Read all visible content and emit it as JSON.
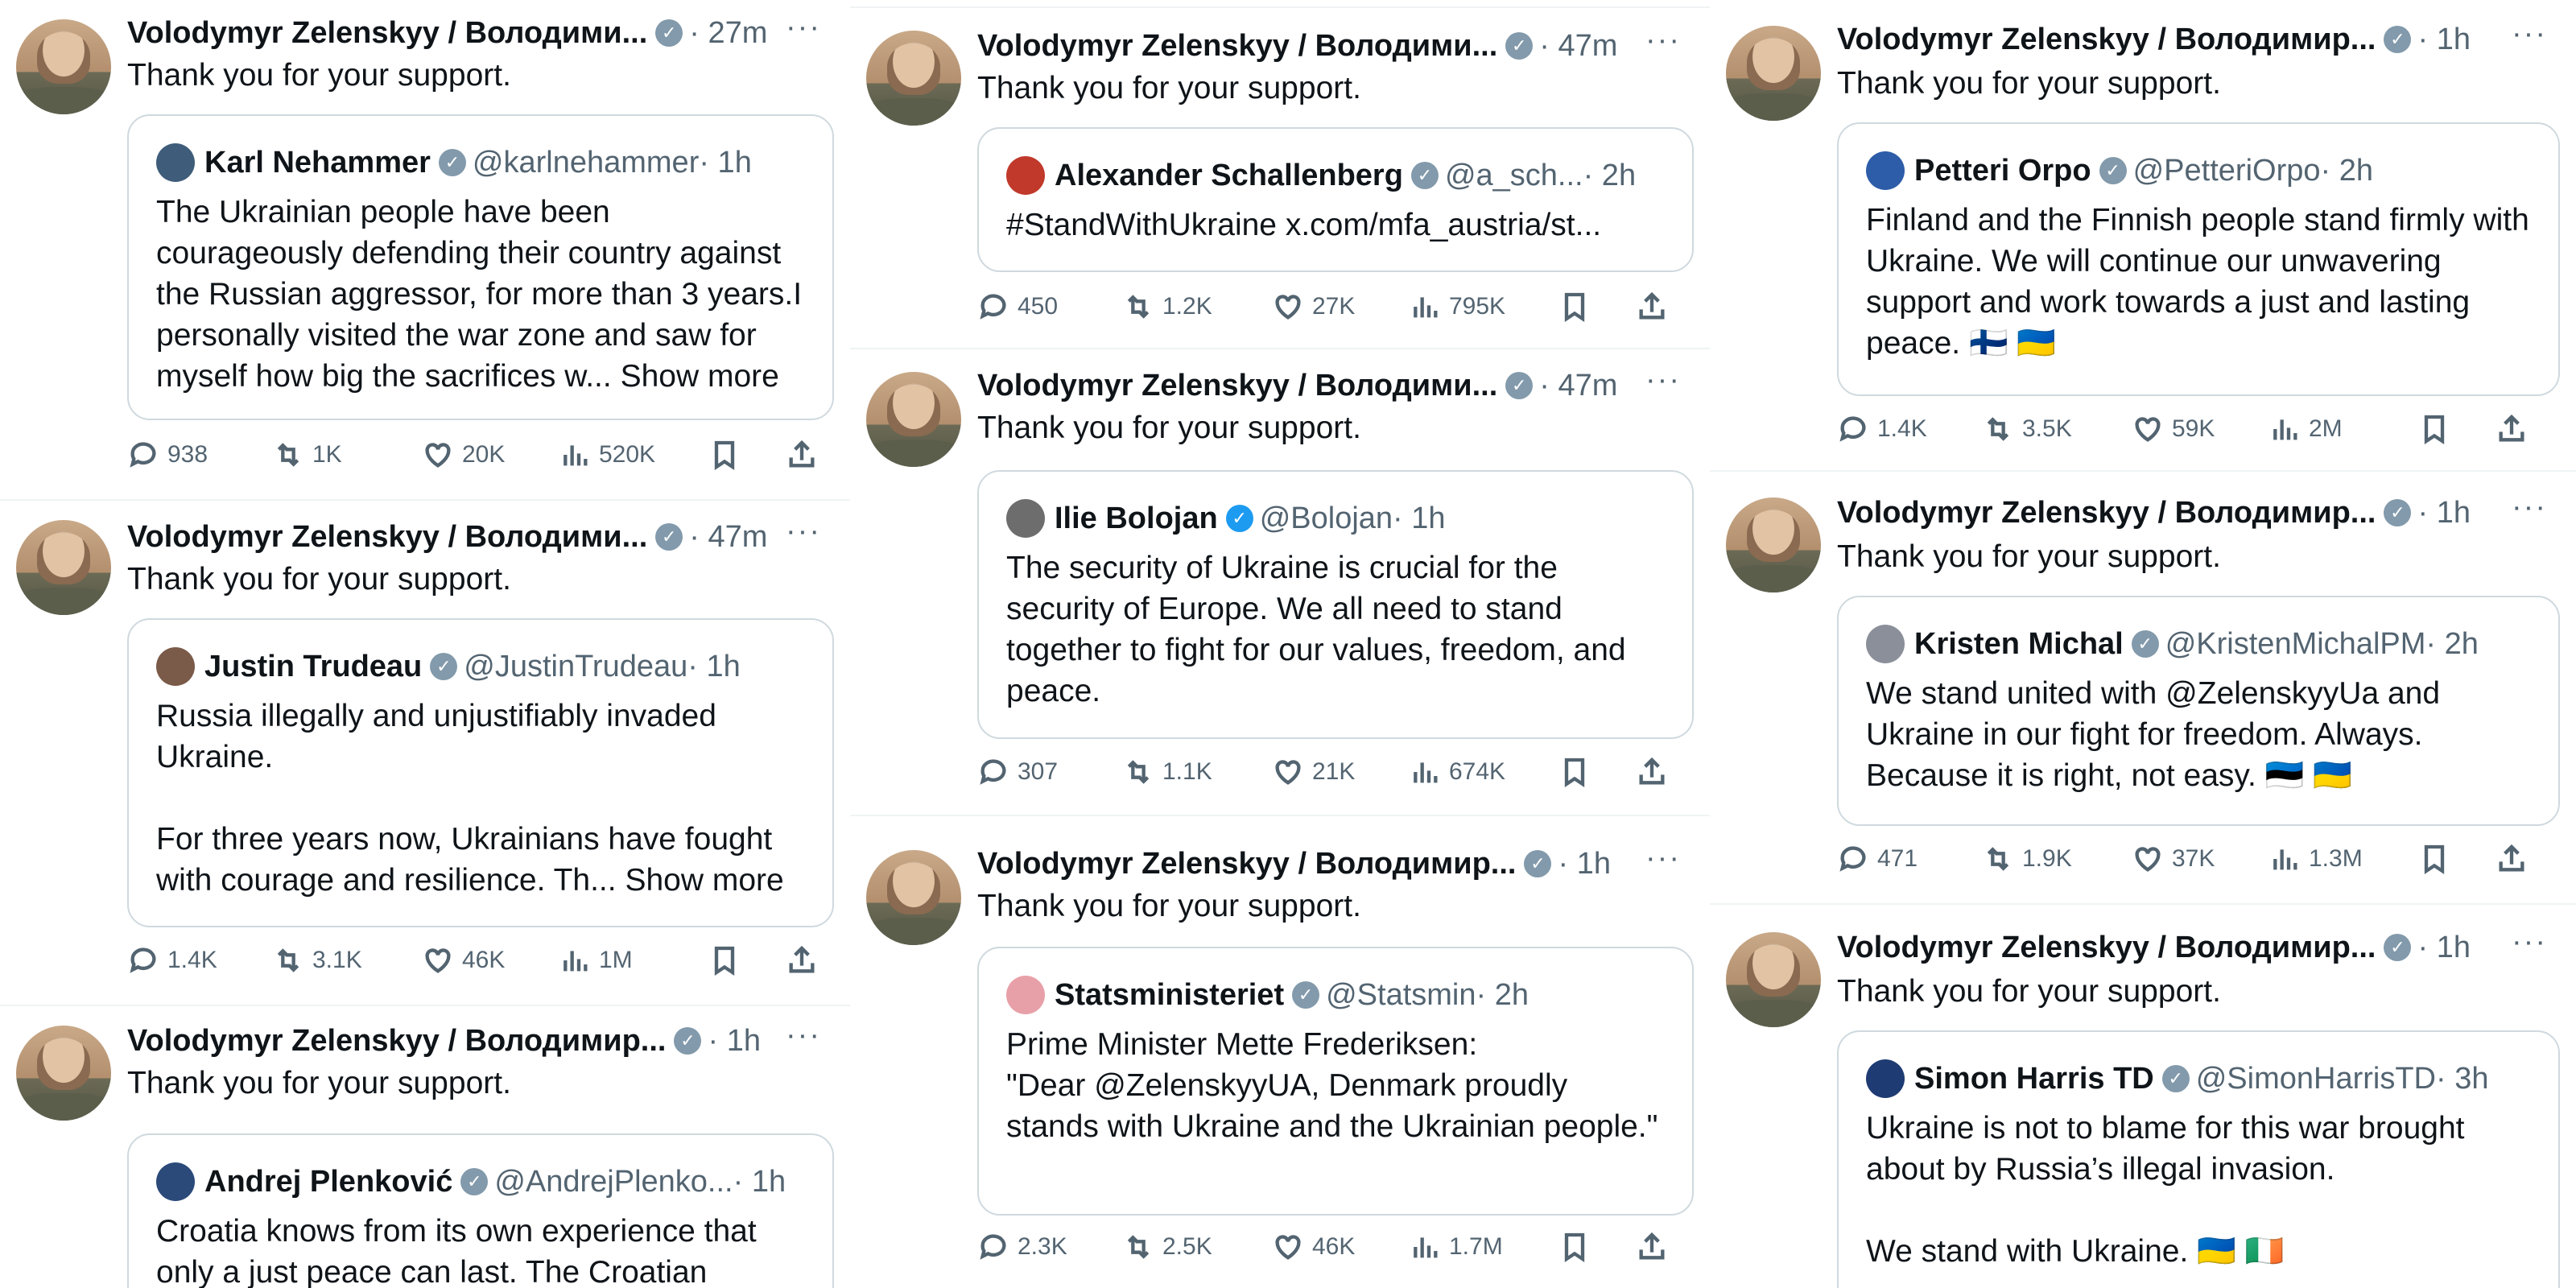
{
  "author": {
    "name": "Volodymyr Zelenskyy / Володими...",
    "name_alt": "Volodymyr Zelenskyy / Володимир...",
    "text": "Thank you for your support."
  },
  "more_label": "···",
  "show_more": "Show more",
  "flags": {
    "finland": "🇫🇮",
    "ukraine": "🇺🇦",
    "estonia": "🇪🇪",
    "ireland": "🇮🇪"
  },
  "tweets": [
    {
      "name": "Volodymyr Zelenskyy / Володими...",
      "time": "· 27m",
      "text": "Thank you for your support.",
      "quote": {
        "name": "Karl Nehammer",
        "handle": "@karlnehammer",
        "time": "· 1h",
        "text": "The Ukrainian people have been courageously defending their country against the Russian aggressor, for more than 3 years.I personally visited the war zone and saw for myself how big the sacrifices w...",
        "avatar_color": "#3f5d7a"
      },
      "stats": {
        "replies": "938",
        "reposts": "1K",
        "likes": "20K",
        "views": "520K"
      }
    },
    {
      "name": "Volodymyr Zelenskyy / Володими...",
      "time": "· 47m",
      "text": "Thank you for your support.",
      "quote": {
        "name": "Justin Trudeau",
        "handle": "@JustinTrudeau",
        "time": "· 1h",
        "text": "Russia illegally and unjustifiably invaded Ukraine.\n\nFor three years now, Ukrainians have fought with courage and resilience. Th...",
        "avatar_color": "#7a5a48"
      },
      "stats": {
        "replies": "1.4K",
        "reposts": "3.1K",
        "likes": "46K",
        "views": "1M"
      }
    },
    {
      "name": "Volodymyr Zelenskyy / Володимир...",
      "time": "· 1h",
      "text": "Thank you for your support.",
      "quote": {
        "name": "Andrej Plenković",
        "handle": "@AndrejPlenko...",
        "time": "· 1h",
        "text": "Croatia knows from its own experience that only a just peace can last. The Croatian",
        "avatar_color": "#2b4a7a"
      }
    },
    {
      "name": "Volodymyr Zelenskyy / Володими...",
      "time": "· 47m",
      "text": "Thank you for your support.",
      "quote": {
        "name": "Alexander Schallenberg",
        "handle": "@a_sch...",
        "time": "· 2h",
        "text": "#StandWithUkraine x.com/mfa_austria/st...",
        "avatar_color": "#c0392b"
      },
      "stats": {
        "replies": "450",
        "reposts": "1.2K",
        "likes": "27K",
        "views": "795K"
      }
    },
    {
      "name": "Volodymyr Zelenskyy / Володими...",
      "time": "· 47m",
      "text": "Thank you for your support.",
      "quote": {
        "name": "Ilie Bolojan",
        "handle": "@Bolojan",
        "time": "· 1h",
        "text": "The security of Ukraine is crucial for the security of Europe. We all need to stand together to fight for our values, freedom, and peace.",
        "avatar_color": "#6d6d6d"
      },
      "stats": {
        "replies": "307",
        "reposts": "1.1K",
        "likes": "21K",
        "views": "674K"
      }
    },
    {
      "name": "Volodymyr Zelenskyy / Володимир...",
      "time": "· 1h",
      "text": "Thank you for your support.",
      "quote": {
        "name": "Statsministeriet",
        "handle": "@Statsmin",
        "time": "· 2h",
        "text": "Prime Minister Mette Frederiksen:\n\"Dear @ZelenskyyUA, Denmark proudly stands with Ukraine and the Ukrainian people.\"",
        "avatar_color": "#e8a0a8"
      },
      "stats": {
        "replies": "2.3K",
        "reposts": "2.5K",
        "likes": "46K",
        "views": "1.7M"
      }
    },
    {
      "name": "Volodymyr Zelenskyy / Володимир...",
      "time": "· 1h",
      "text": "Thank you for your support.",
      "quote": {
        "name": "Petteri Orpo",
        "handle": "@PetteriOrpo",
        "time": "· 2h",
        "text": "Finland and the Finnish people stand firmly with Ukraine. We will continue our unwavering support and work towards a just and lasting peace.",
        "avatar_color": "#2d5da8"
      },
      "stats": {
        "replies": "1.4K",
        "reposts": "3.5K",
        "likes": "59K",
        "views": "2M"
      }
    },
    {
      "name": "Volodymyr Zelenskyy / Володимир...",
      "time": "· 1h",
      "text": "Thank you for your support.",
      "quote": {
        "name": "Kristen Michal",
        "handle": "@KristenMichalPM",
        "time": "· 2h",
        "text": "We stand united with @ZelenskyyUa and Ukraine in our fight for freedom. Always. Because it is right, not easy.",
        "avatar_color": "#8a8f99"
      },
      "stats": {
        "replies": "471",
        "reposts": "1.9K",
        "likes": "37K",
        "views": "1.3M"
      }
    },
    {
      "name": "Volodymyr Zelenskyy / Володимир...",
      "time": "· 1h",
      "text": "Thank you for your support.",
      "quote": {
        "name": "Simon Harris TD",
        "handle": "@SimonHarrisTD",
        "time": "· 3h",
        "text": "Ukraine is not to blame for this war brought about by Russia’s illegal invasion.\n\nWe stand with Ukraine.",
        "avatar_color": "#1f3b73"
      }
    }
  ]
}
